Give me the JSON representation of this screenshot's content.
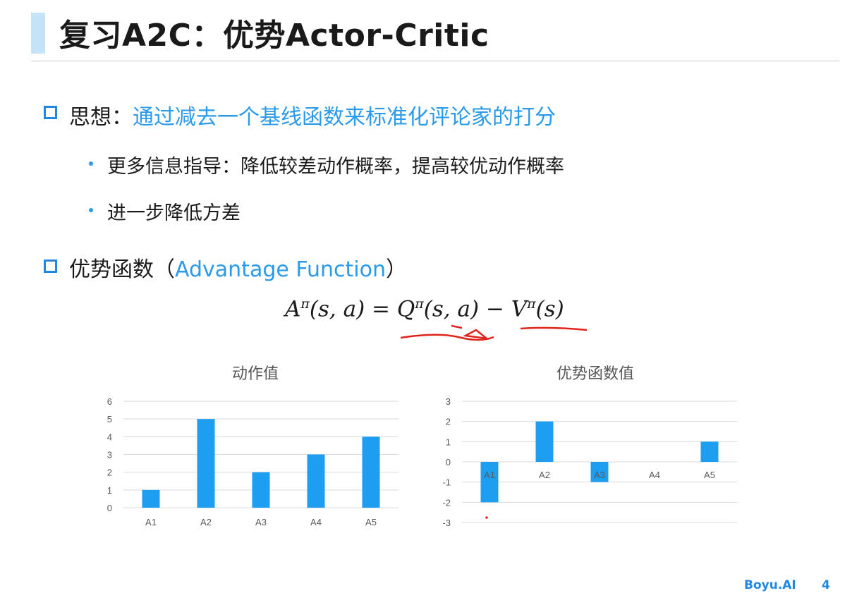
{
  "slide": {
    "title": "复习A2C：优势Actor-Critic",
    "idea_label": "思想：",
    "idea_text": "通过减去一个基线函数来标准化评论家的打分",
    "sub_bullets": [
      "更多信息指导：降低较差动作概率，提高较优动作概率",
      "进一步降低方差"
    ],
    "adv_label": "优势函数（",
    "adv_term": "Advantage Function",
    "adv_close": "）",
    "formula": {
      "lhs": "A",
      "lhs_args": "(s, a) = ",
      "q": "Q",
      "q_args": "(s, a) − ",
      "v": "V",
      "v_args": "(s)",
      "pi": "π"
    },
    "footer_brand": "Boyu.AI",
    "page_number": "4"
  },
  "chart_data": [
    {
      "type": "bar",
      "title": "动作值",
      "categories": [
        "A1",
        "A2",
        "A3",
        "A4",
        "A5"
      ],
      "values": [
        1,
        5,
        2,
        3,
        4
      ],
      "ylim": [
        0,
        6
      ],
      "yticks": [
        "0",
        "1",
        "2",
        "3",
        "4",
        "5",
        "6"
      ],
      "grid": true,
      "color": "#1e9ef0"
    },
    {
      "type": "bar",
      "title": "优势函数值",
      "categories": [
        "A1",
        "A2",
        "A3",
        "A4",
        "A5"
      ],
      "values": [
        -2,
        2,
        -1,
        0,
        1
      ],
      "ylim": [
        -3,
        3
      ],
      "yticks": [
        "-3",
        "-2",
        "-1",
        "0",
        "1",
        "2",
        "3"
      ],
      "grid": true,
      "color": "#1e9ef0"
    }
  ],
  "colors": {
    "accent": "#2b9ae8",
    "bar": "#1e9ef0",
    "annotation": "#e0241c"
  }
}
